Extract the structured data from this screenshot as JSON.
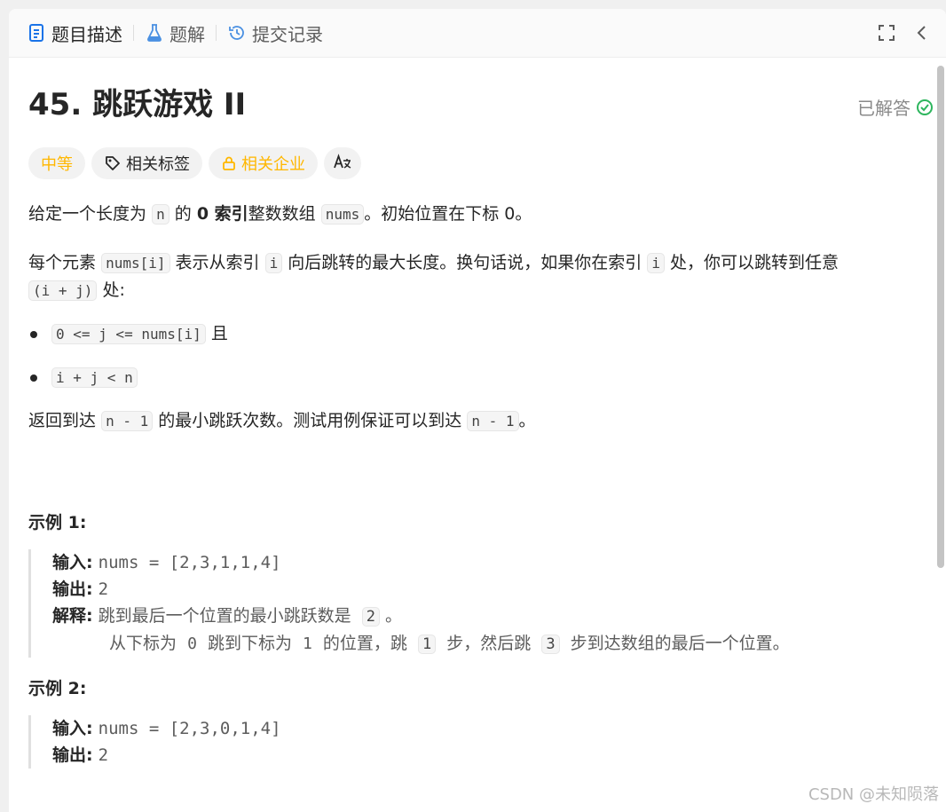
{
  "tabs": [
    {
      "label": "题目描述",
      "icon": "description-icon",
      "active": true
    },
    {
      "label": "题解",
      "icon": "flask-icon",
      "active": false
    },
    {
      "label": "提交记录",
      "icon": "history-icon",
      "active": false
    }
  ],
  "problem": {
    "title": "45. 跳跃游戏 II",
    "status": "已解答",
    "tags": {
      "difficulty": "中等",
      "related_tags": "相关标签",
      "related_companies": "相关企业"
    }
  },
  "description": {
    "p1": {
      "a": "给定一个长度为",
      "code1": "n",
      "b": "的",
      "bold": "0 索引",
      "c": "整数数组",
      "code2": "nums",
      "d": "。初始位置在下标 0。"
    },
    "p2": {
      "a": "每个元素",
      "code1": "nums[i]",
      "b": "表示从索引",
      "code2": "i",
      "c": "向后跳转的最大长度。换句话说，如果你在索引",
      "code3": "i",
      "d": "处，你可以跳转到任意",
      "code4": "(i + j)",
      "e": "处:"
    },
    "bullets": [
      {
        "code": "0 <= j <= nums[i]",
        "text": "且"
      },
      {
        "code": "i + j < n",
        "text": ""
      }
    ],
    "p3": {
      "a": "返回到达",
      "code1": "n - 1",
      "b": "的最小跳跃次数。测试用例保证可以到达",
      "code2": "n - 1",
      "c": "。"
    }
  },
  "examples": [
    {
      "title": "示例 1:",
      "input_label": "输入:",
      "input": "nums = [2,3,1,1,4]",
      "output_label": "输出:",
      "output": "2",
      "explain_label": "解释:",
      "explain1": {
        "a": "跳到最后一个位置的最小跳跃数是",
        "code": "2",
        "b": "。"
      },
      "explain2": {
        "a": "从下标为",
        "c1": "0",
        "b": "跳到下标为",
        "c2": "1",
        "c": "的位置，跳",
        "c3": "1",
        "d": "步，然后跳",
        "c4": "3",
        "e": "步到达数组的最后一个位置。"
      }
    },
    {
      "title": "示例 2:",
      "input_label": "输入:",
      "input": "nums = [2,3,0,1,4]",
      "output_label": "输出:",
      "output": "2"
    }
  ],
  "watermark": "CSDN @未知陨落",
  "colors": {
    "accent_green": "#2db55d",
    "difficulty_yellow": "#ffb700",
    "tab_blue": "#1a73e8"
  }
}
